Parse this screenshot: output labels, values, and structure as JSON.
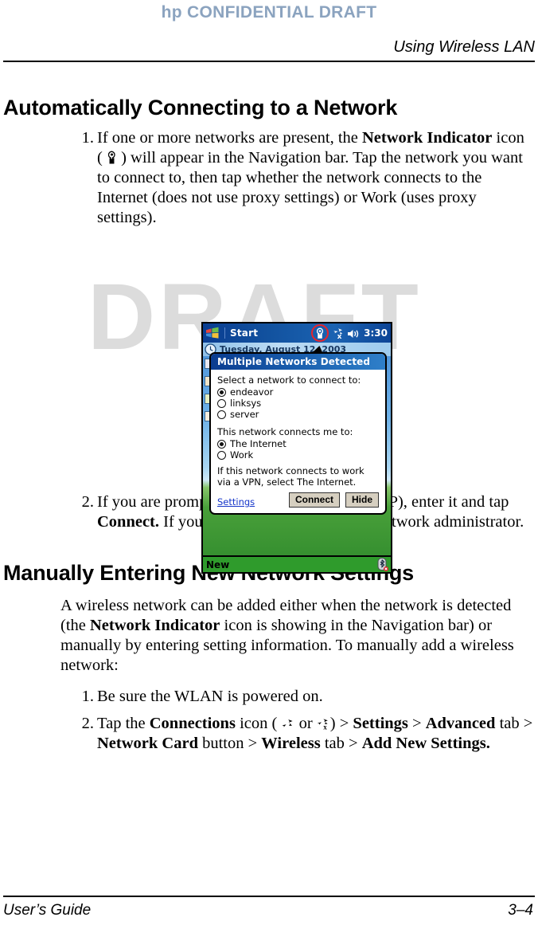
{
  "header": {
    "confidential": "hp CONFIDENTIAL DRAFT",
    "chapter": "Using Wireless LAN",
    "confidential_color": "#8ba3bf"
  },
  "watermark": {
    "text": "DRAFT",
    "color": "#dcdcdc"
  },
  "sections": {
    "auto": {
      "heading": "Automatically Connecting to a Network",
      "step1": {
        "number": "1.",
        "part1": "If one or more networks are present, the ",
        "bold1": "Network Indicator",
        "part2": " icon ( ",
        "icon": "network-indicator-icon",
        "part3": " ) will appear in the Navigation bar. Tap the network you want to connect to, then tap whether the network connects to the Internet (does not use proxy settings) or Work (uses proxy settings)."
      },
      "step2": {
        "number": "2.",
        "part1": "If you are prompted for a Network Key (WEP), enter it and tap ",
        "bold1": "Connect.",
        "part2": " If you are not sure, contact your network administrator."
      }
    },
    "manual": {
      "heading": "Manually Entering New Network Settings",
      "intro_part1": "A wireless network can be added either when the network is detected (the ",
      "intro_bold": "Network Indicator",
      "intro_part2": " icon is showing in the Navigation bar) or manually by entering setting information. To manually add a wireless network:",
      "step1": {
        "number": "1.",
        "text": "Be sure the WLAN is powered on."
      },
      "step2": {
        "number": "2.",
        "part1": "Tap the ",
        "bold1": "Connections",
        "part2": " icon ( ",
        "icon1": "connections-icon",
        "part3": "  or ",
        "icon2": "connections-disconnected-icon",
        "part4": ") > ",
        "bold2": "Settings",
        "part5": " > ",
        "bold3": "Advanced",
        "part6": " tab > ",
        "bold4": "Network Card",
        "part7": " button > ",
        "bold5": "Wireless",
        "part8": " tab > ",
        "bold6": "Add New Settings."
      }
    }
  },
  "pda": {
    "titlebar": {
      "start_label": "Start",
      "clock": "3:30",
      "network_indicator_icon": "network-indicator-icon",
      "connections_icon": "connections-disconnected-icon",
      "volume_icon": "speaker-icon",
      "highlight_color": "#e8242b"
    },
    "today_bar": {
      "date": "Tuesday, August 12, 2003"
    },
    "dialog": {
      "title": "Multiple Networks Detected",
      "select_label": "Select a network to connect to:",
      "networks": [
        {
          "label": "endeavor",
          "selected": true
        },
        {
          "label": "linksys",
          "selected": false
        },
        {
          "label": "server",
          "selected": false
        }
      ],
      "connects_label": "This network connects me to:",
      "destinations": [
        {
          "label": "The Internet",
          "selected": true
        },
        {
          "label": "Work",
          "selected": false
        }
      ],
      "note": "If this network connects to work via a VPN, select The Internet.",
      "settings_link": "Settings",
      "connect_button": "Connect",
      "hide_button": "Hide"
    },
    "command_bar": {
      "new_label": "New",
      "bluetooth_icon": "bluetooth-icon"
    }
  },
  "footer": {
    "left": "User’s Guide",
    "right": "3–4"
  }
}
